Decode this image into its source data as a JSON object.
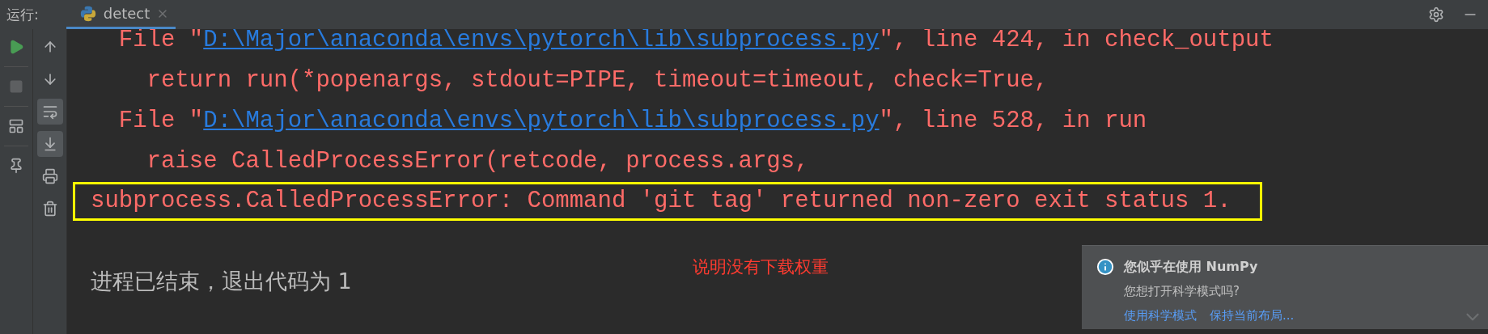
{
  "header": {
    "label": "运行:",
    "tabs": [
      {
        "label": "detect",
        "selected": true
      }
    ]
  },
  "left_tools": [
    {
      "kind": "run",
      "disabled": false
    },
    {
      "kind": "stop",
      "disabled": true
    },
    {
      "kind": "layout",
      "disabled": false
    },
    {
      "kind": "pin",
      "disabled": false
    }
  ],
  "right_tools": [
    {
      "kind": "up",
      "on": false
    },
    {
      "kind": "down",
      "on": false
    },
    {
      "kind": "wrap",
      "on": true
    },
    {
      "kind": "scroll-end",
      "on": true
    },
    {
      "kind": "print",
      "on": false
    },
    {
      "kind": "trash",
      "on": false
    }
  ],
  "console": {
    "lines": [
      {
        "kind": "file",
        "prefix": "  File \"",
        "link": "D:\\Major\\anaconda\\envs\\pytorch\\lib\\subprocess.py",
        "suffix": "\", line 424, in check_output"
      },
      {
        "kind": "code",
        "text": "    return run(*popenargs, stdout=PIPE, timeout=timeout, check=True,"
      },
      {
        "kind": "file",
        "prefix": "  File \"",
        "link": "D:\\Major\\anaconda\\envs\\pytorch\\lib\\subprocess.py",
        "suffix": "\", line 528, in run"
      },
      {
        "kind": "code",
        "text": "    raise CalledProcessError(retcode, process.args,"
      },
      {
        "kind": "error",
        "text": "subprocess.CalledProcessError: Command 'git tag' returned non-zero exit status 1."
      }
    ],
    "exit_message": "进程已结束，退出代码为 1",
    "annotation": "说明没有下载权重"
  },
  "notification": {
    "title": "您似乎在使用 NumPy",
    "text": "您想打开科学模式吗?",
    "actions": [
      "使用科学模式",
      "保持当前布局..."
    ]
  }
}
